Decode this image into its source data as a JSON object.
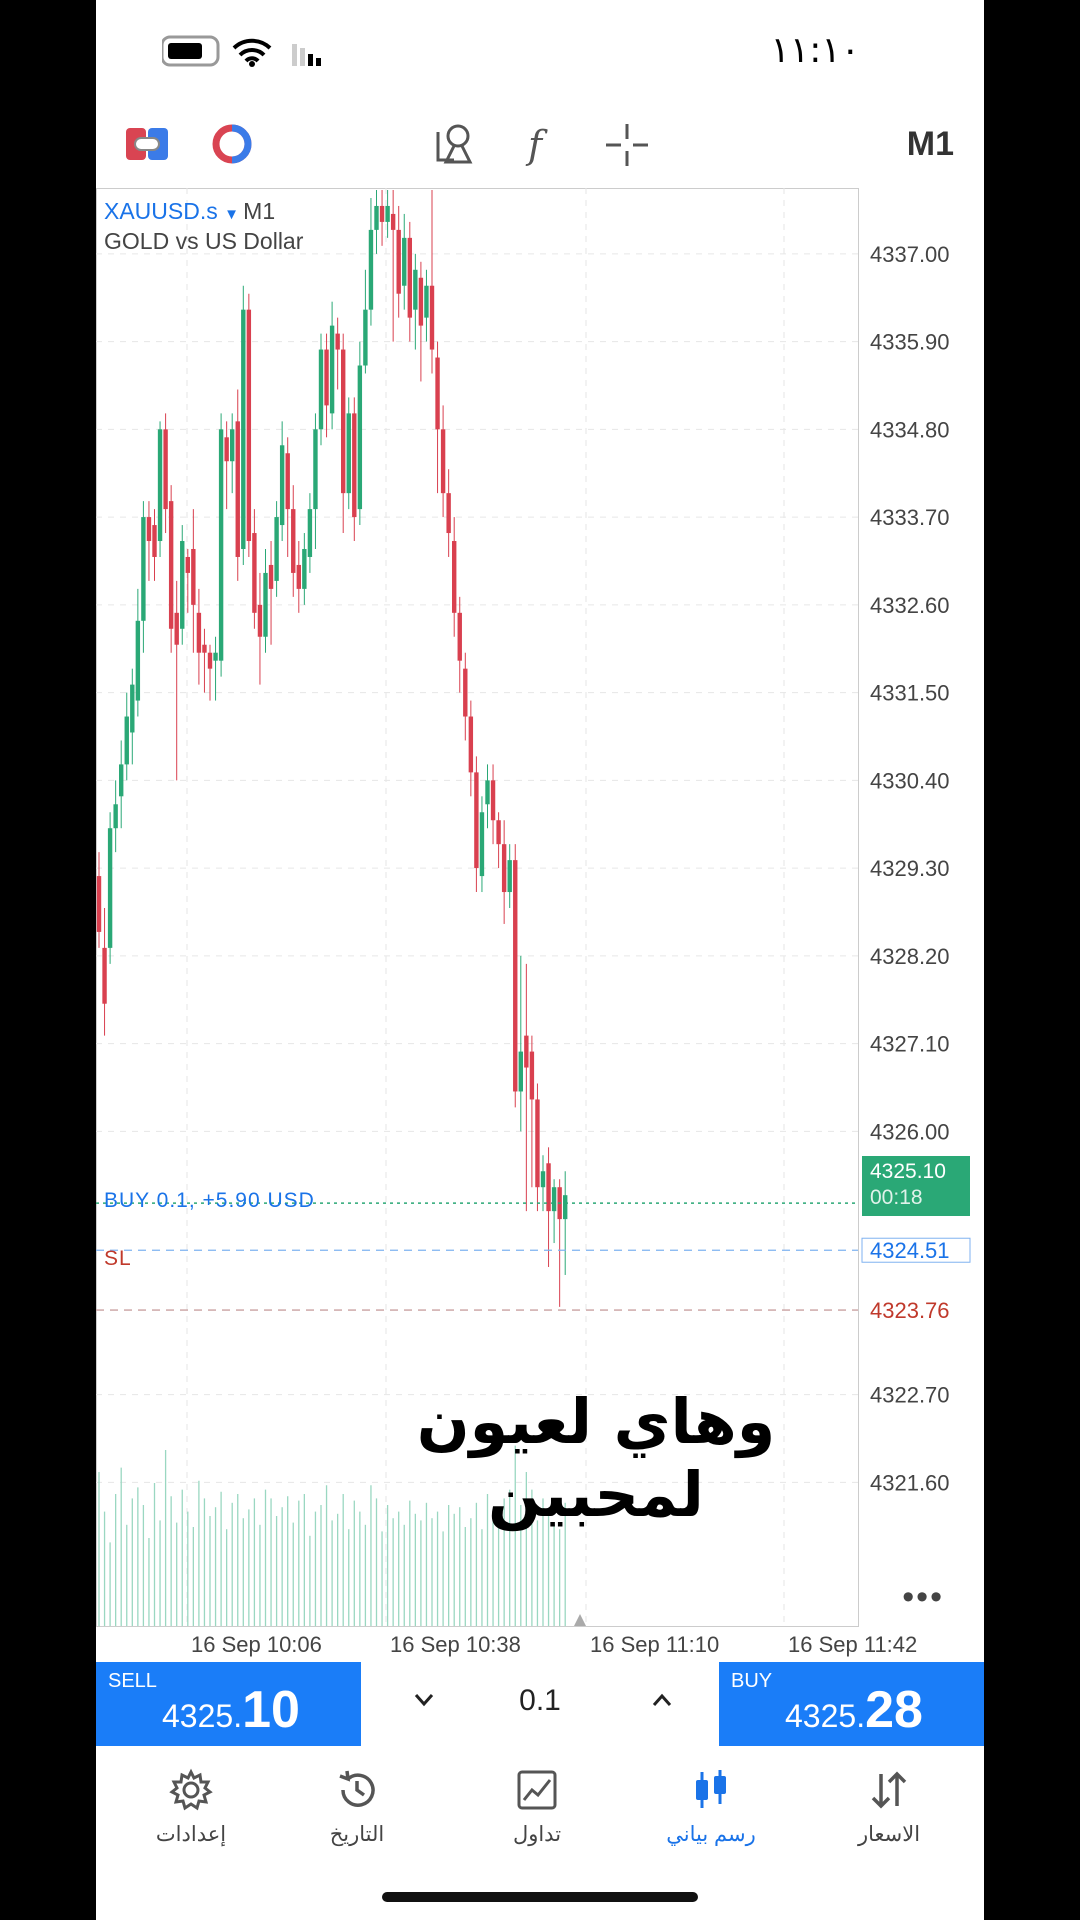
{
  "status_bar": {
    "time": "١١:١٠"
  },
  "toolbar": {
    "timeframe": "M1",
    "icons": [
      "one-click-trading-icon",
      "depth-of-market-icon",
      "objects-icon",
      "indicators-icon",
      "crosshair-icon"
    ]
  },
  "chart": {
    "symbol": "XAUUSD.s",
    "symbol_timeframe": "M1",
    "description": "GOLD vs US Dollar",
    "current_price_tag": {
      "price": "4325.10",
      "countdown": "00:18"
    },
    "buy_position_label": "BUY 0.1, +5.90 USD",
    "buy_position_price": "4324.51",
    "sl_label": "SL",
    "sl_price": "4323.76",
    "caption_overlay": "وهاي لعيون لمحبين",
    "colors": {
      "up": "#2aa876",
      "down": "#d9404f",
      "buy_line": "#1a73e8",
      "sl_line": "#c0392b"
    }
  },
  "chart_data": {
    "type": "candlestick",
    "y_ticks": [
      "4337.00",
      "4335.90",
      "4334.80",
      "4333.70",
      "4332.60",
      "4331.50",
      "4330.40",
      "4329.30",
      "4328.20",
      "4327.10",
      "4326.00",
      "4322.70",
      "4321.60"
    ],
    "x_ticks": [
      "16 Sep 10:06",
      "16 Sep 10:38",
      "16 Sep 11:10",
      "16 Sep 11:42"
    ],
    "ylim": [
      4319.9,
      4337.8
    ],
    "candles": [
      [
        4329.2,
        4328.5,
        4328.3,
        4329.5
      ],
      [
        4328.3,
        4327.6,
        4327.2,
        4328.8
      ],
      [
        4328.3,
        4329.8,
        4328.1,
        4330.0
      ],
      [
        4329.8,
        4330.1,
        4329.5,
        4330.4
      ],
      [
        4330.2,
        4330.6,
        4329.8,
        4330.9
      ],
      [
        4330.6,
        4331.2,
        4330.4,
        4331.5
      ],
      [
        4331.0,
        4331.6,
        4330.6,
        4331.8
      ],
      [
        4331.4,
        4332.4,
        4331.2,
        4332.8
      ],
      [
        4332.4,
        4333.7,
        4332.0,
        4333.9
      ],
      [
        4333.7,
        4333.4,
        4332.9,
        4333.9
      ],
      [
        4333.6,
        4333.2,
        4332.9,
        4333.8
      ],
      [
        4333.4,
        4334.8,
        4333.2,
        4334.9
      ],
      [
        4334.8,
        4333.8,
        4333.5,
        4335.0
      ],
      [
        4333.9,
        4332.3,
        4332.0,
        4334.1
      ],
      [
        4332.5,
        4332.1,
        4330.4,
        4332.9
      ],
      [
        4332.3,
        4333.4,
        4332.1,
        4333.6
      ],
      [
        4333.2,
        4333.0,
        4332.5,
        4333.3
      ],
      [
        4333.3,
        4332.6,
        4332.0,
        4333.8
      ],
      [
        4332.5,
        4332.0,
        4331.6,
        4332.8
      ],
      [
        4332.1,
        4332.0,
        4331.5,
        4332.3
      ],
      [
        4332.0,
        4331.8,
        4331.4,
        4332.1
      ],
      [
        4331.9,
        4332.0,
        4331.4,
        4332.2
      ],
      [
        4331.9,
        4334.8,
        4331.7,
        4335.0
      ],
      [
        4334.7,
        4334.4,
        4333.8,
        4334.9
      ],
      [
        4334.4,
        4334.8,
        4334.0,
        4335.0
      ],
      [
        4334.9,
        4333.2,
        4332.9,
        4335.3
      ],
      [
        4333.3,
        4336.3,
        4333.1,
        4336.6
      ],
      [
        4336.3,
        4333.4,
        4333.2,
        4336.5
      ],
      [
        4333.5,
        4332.5,
        4332.3,
        4333.8
      ],
      [
        4332.6,
        4332.2,
        4331.6,
        4333.0
      ],
      [
        4332.2,
        4333.0,
        4332.0,
        4333.3
      ],
      [
        4333.1,
        4332.8,
        4332.1,
        4333.4
      ],
      [
        4332.9,
        4333.7,
        4332.7,
        4333.9
      ],
      [
        4333.6,
        4334.6,
        4333.4,
        4334.9
      ],
      [
        4334.5,
        4333.8,
        4333.2,
        4334.7
      ],
      [
        4333.8,
        4333.0,
        4332.7,
        4334.1
      ],
      [
        4333.1,
        4332.8,
        4332.5,
        4333.4
      ],
      [
        4332.8,
        4333.3,
        4332.6,
        4333.5
      ],
      [
        4333.2,
        4333.8,
        4333.0,
        4334.0
      ],
      [
        4333.8,
        4334.8,
        4333.3,
        4335.0
      ],
      [
        4334.8,
        4335.8,
        4334.6,
        4336.0
      ],
      [
        4335.8,
        4335.1,
        4334.7,
        4336.0
      ],
      [
        4335.0,
        4336.1,
        4334.8,
        4336.4
      ],
      [
        4336.0,
        4335.8,
        4335.3,
        4336.2
      ],
      [
        4335.8,
        4334.0,
        4333.5,
        4336.0
      ],
      [
        4334.0,
        4335.0,
        4333.8,
        4335.2
      ],
      [
        4335.0,
        4333.7,
        4333.4,
        4335.2
      ],
      [
        4333.8,
        4335.6,
        4333.6,
        4335.9
      ],
      [
        4335.6,
        4336.3,
        4335.5,
        4336.8
      ],
      [
        4336.3,
        4337.3,
        4336.1,
        4337.7
      ],
      [
        4337.3,
        4337.6,
        4337.0,
        4337.8
      ],
      [
        4337.6,
        4337.4,
        4337.1,
        4337.8
      ],
      [
        4337.4,
        4337.6,
        4337.2,
        4337.8
      ],
      [
        4337.5,
        4337.3,
        4335.9,
        4337.8
      ],
      [
        4337.3,
        4336.5,
        4336.2,
        4337.6
      ],
      [
        4336.6,
        4337.2,
        4336.3,
        4337.5
      ],
      [
        4337.2,
        4336.2,
        4335.9,
        4337.4
      ],
      [
        4336.3,
        4336.8,
        4335.8,
        4337.0
      ],
      [
        4336.7,
        4336.1,
        4335.4,
        4336.9
      ],
      [
        4336.2,
        4336.6,
        4335.9,
        4336.8
      ],
      [
        4336.6,
        4335.8,
        4335.5,
        4337.8
      ],
      [
        4335.7,
        4334.8,
        4334.0,
        4335.9
      ],
      [
        4334.8,
        4334.0,
        4333.7,
        4335.1
      ],
      [
        4334.0,
        4333.5,
        4333.2,
        4334.3
      ],
      [
        4333.4,
        4332.5,
        4332.2,
        4333.7
      ],
      [
        4332.5,
        4331.9,
        4331.5,
        4332.7
      ],
      [
        4331.8,
        4331.2,
        4330.9,
        4332.0
      ],
      [
        4331.2,
        4330.5,
        4330.2,
        4331.4
      ],
      [
        4330.5,
        4329.3,
        4329.0,
        4330.7
      ],
      [
        4329.2,
        4330.0,
        4329.0,
        4330.2
      ],
      [
        4330.1,
        4330.4,
        4329.8,
        4330.6
      ],
      [
        4330.4,
        4329.9,
        4329.6,
        4330.6
      ],
      [
        4329.9,
        4329.6,
        4329.3,
        4330.0
      ],
      [
        4329.6,
        4329.0,
        4328.6,
        4329.9
      ],
      [
        4329.0,
        4329.4,
        4328.8,
        4329.6
      ],
      [
        4329.4,
        4326.5,
        4326.3,
        4329.6
      ],
      [
        4326.5,
        4327.0,
        4326.0,
        4328.2
      ],
      [
        4327.2,
        4326.8,
        4325.0,
        4328.1
      ],
      [
        4327.0,
        4326.4,
        4325.3,
        4327.2
      ],
      [
        4326.4,
        4325.3,
        4325.0,
        4326.6
      ],
      [
        4325.3,
        4325.5,
        4325.0,
        4325.7
      ],
      [
        4325.6,
        4325.0,
        4324.3,
        4325.8
      ],
      [
        4325.0,
        4325.3,
        4324.6,
        4325.4
      ],
      [
        4325.3,
        4324.9,
        4323.8,
        4325.4
      ],
      [
        4324.9,
        4325.2,
        4324.2,
        4325.5
      ]
    ],
    "volumes": [
      70,
      52,
      38,
      60,
      72,
      46,
      58,
      63,
      55,
      40,
      65,
      48,
      80,
      59,
      47,
      62,
      52,
      45,
      66,
      58,
      50,
      54,
      61,
      44,
      56,
      60,
      49,
      53,
      58,
      46,
      62,
      58,
      50,
      54,
      59,
      47,
      57,
      60,
      41,
      52,
      55,
      64,
      48,
      51,
      60,
      44,
      57,
      52,
      46,
      64,
      58,
      43,
      55,
      49,
      52,
      46,
      57,
      51,
      48,
      56,
      49,
      52,
      43,
      55,
      51,
      54,
      45,
      49,
      56,
      44,
      60,
      52,
      48,
      58,
      62,
      82,
      55,
      70,
      62,
      48,
      58,
      53,
      46,
      44,
      56
    ]
  },
  "trade_bar": {
    "sell_label": "SELL",
    "sell_price_prefix": "4325.",
    "sell_price_big": "10",
    "volume": "0.1",
    "buy_label": "BUY",
    "buy_price_prefix": "4325.",
    "buy_price_big": "28"
  },
  "nav": {
    "items": [
      {
        "label": "إعدادات",
        "icon": "gear-icon"
      },
      {
        "label": "التاريخ",
        "icon": "history-icon"
      },
      {
        "label": "تداول",
        "icon": "trade-chart-icon"
      },
      {
        "label": "رسم بياني",
        "icon": "candlestick-icon",
        "active": true
      },
      {
        "label": "الاسعار",
        "icon": "quotes-arrows-icon"
      }
    ]
  }
}
